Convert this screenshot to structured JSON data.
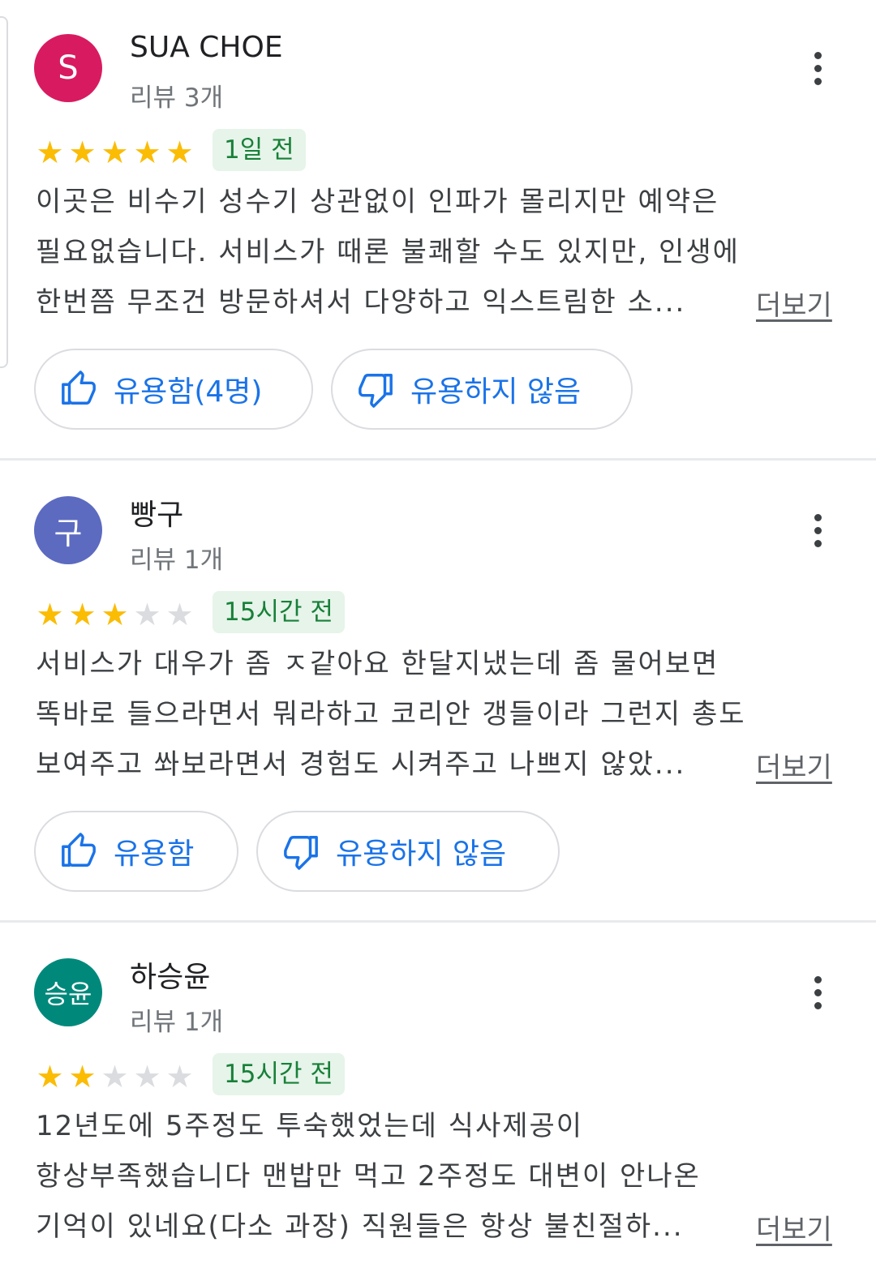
{
  "reviews": [
    {
      "name": "SUA CHOE",
      "avatar_text": "S",
      "avatar_color": "#d81b60",
      "review_count": "리뷰 3개",
      "rating": 5,
      "date": "1일 전",
      "text_lines": [
        "이곳은 비수기 성수기 상관없이 인파가 몰리지만 예약은",
        "필요없습니다. 서비스가 때론 불쾌할 수도 있지만, 인생에",
        "한번쯤 무조건 방문하셔서 다양하고 익스트림한 소..."
      ],
      "more_label": "더보기",
      "helpful_label": "유용함(4명)",
      "not_helpful_label": "유용하지 않음"
    },
    {
      "name": "빵구",
      "avatar_text": "구",
      "avatar_color": "#5c6bc0",
      "review_count": "리뷰 1개",
      "rating": 3,
      "date": "15시간 전",
      "text_lines": [
        "서비스가 대우가 좀 ㅈ같아요 한달지냈는데 좀 물어보면",
        "똑바로 들으라면서 뭐라하고 코리안 갱들이라 그런지 총도",
        "보여주고 쏴보라면서 경험도 시켜주고 나쁘지 않았..."
      ],
      "more_label": "더보기",
      "helpful_label": "유용함",
      "not_helpful_label": "유용하지 않음"
    },
    {
      "name": "하승윤",
      "avatar_text": "승윤",
      "avatar_color": "#00897b",
      "review_count": "리뷰 1개",
      "rating": 2,
      "date": "15시간 전",
      "text_lines": [
        "12년도에 5주정도 투숙했었는데 식사제공이",
        "항상부족했습니다 맨밥만 먹고 2주정도 대변이 안나온",
        "기억이 있네요(다소 과장) 직원들은 항상 불친절하..."
      ],
      "more_label": "더보기"
    }
  ]
}
